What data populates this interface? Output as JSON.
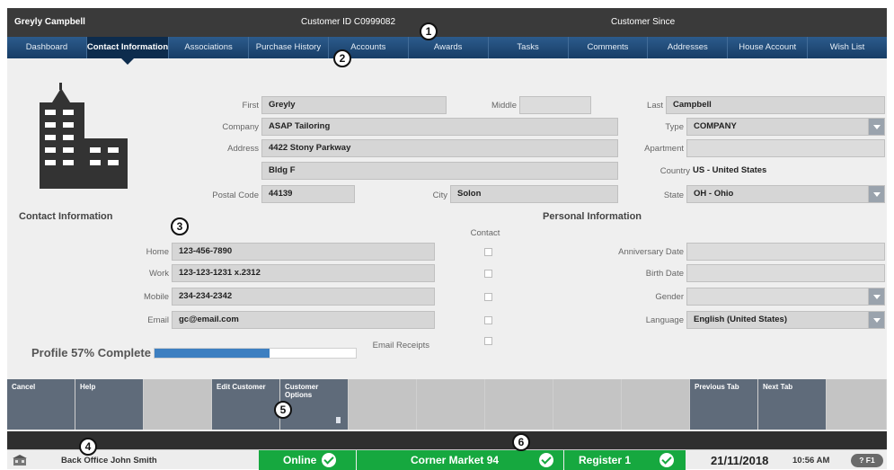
{
  "header": {
    "customer_name": "Greyly Campbell",
    "customer_id": "Customer ID C0999082",
    "customer_since": "Customer Since"
  },
  "tabs": [
    {
      "label": "Dashboard",
      "active": false
    },
    {
      "label": "Contact Information",
      "active": true
    },
    {
      "label": "Associations",
      "active": false
    },
    {
      "label": "Purchase History",
      "active": false
    },
    {
      "label": "Accounts",
      "active": false
    },
    {
      "label": "Awards",
      "active": false
    },
    {
      "label": "Tasks",
      "active": false
    },
    {
      "label": "Comments",
      "active": false
    },
    {
      "label": "Addresses",
      "active": false
    },
    {
      "label": "House Account",
      "active": false
    },
    {
      "label": "Wish List",
      "active": false
    }
  ],
  "callouts": [
    "1",
    "2",
    "3",
    "4",
    "5",
    "6"
  ],
  "form": {
    "first_label": "First",
    "first_value": "Greyly",
    "middle_label": "Middle",
    "middle_value": "",
    "last_label": "Last",
    "last_value": "Campbell",
    "company_label": "Company",
    "company_value": "ASAP Tailoring",
    "type_label": "Type",
    "type_value": "COMPANY",
    "address_label": "Address",
    "address_line1": "4422 Stony Parkway",
    "address_line2": "Bldg F",
    "apartment_label": "Apartment",
    "apartment_value": "",
    "country_label": "Country",
    "country_value": "US - United States",
    "postal_label": "Postal Code",
    "postal_value": "44139",
    "city_label": "City",
    "city_value": "Solon",
    "state_label": "State",
    "state_value": "OH - Ohio"
  },
  "contact": {
    "section_title": "Contact Information",
    "contact_header": "Contact",
    "home_label": "Home",
    "home_value": "123-456-7890",
    "work_label": "Work",
    "work_value": "123-123-1231 x.2312",
    "mobile_label": "Mobile",
    "mobile_value": "234-234-2342",
    "email_label": "Email",
    "email_value": "gc@email.com",
    "email_receipts_label": "Email Receipts"
  },
  "personal": {
    "section_title": "Personal Information",
    "anniversary_label": "Anniversary Date",
    "anniversary_value": "",
    "birth_label": "Birth Date",
    "birth_value": "",
    "gender_label": "Gender",
    "gender_value": "",
    "language_label": "Language",
    "language_value": "English (United States)"
  },
  "profile": {
    "label": "Profile 57% Complete",
    "percent": 57
  },
  "actions": [
    {
      "label": "Cancel",
      "enabled": true
    },
    {
      "label": "Help",
      "enabled": true
    },
    {
      "label": "",
      "enabled": false
    },
    {
      "label": "Edit Customer",
      "enabled": true
    },
    {
      "label": "Customer Options",
      "enabled": true,
      "icon": "trash-icon"
    },
    {
      "label": "",
      "enabled": false
    },
    {
      "label": "",
      "enabled": false
    },
    {
      "label": "",
      "enabled": false
    },
    {
      "label": "",
      "enabled": false
    },
    {
      "label": "",
      "enabled": false
    },
    {
      "label": "Previous Tab",
      "enabled": true
    },
    {
      "label": "Next Tab",
      "enabled": true
    },
    {
      "label": "",
      "enabled": false
    }
  ],
  "status": {
    "office": "Back Office",
    "user": "John Smith",
    "online": "Online",
    "store": "Corner Market 94",
    "register": "Register 1",
    "date": "21/11/2018",
    "time": "10:56 AM",
    "help_key": "? F1",
    "status_color": "#16a83f"
  }
}
